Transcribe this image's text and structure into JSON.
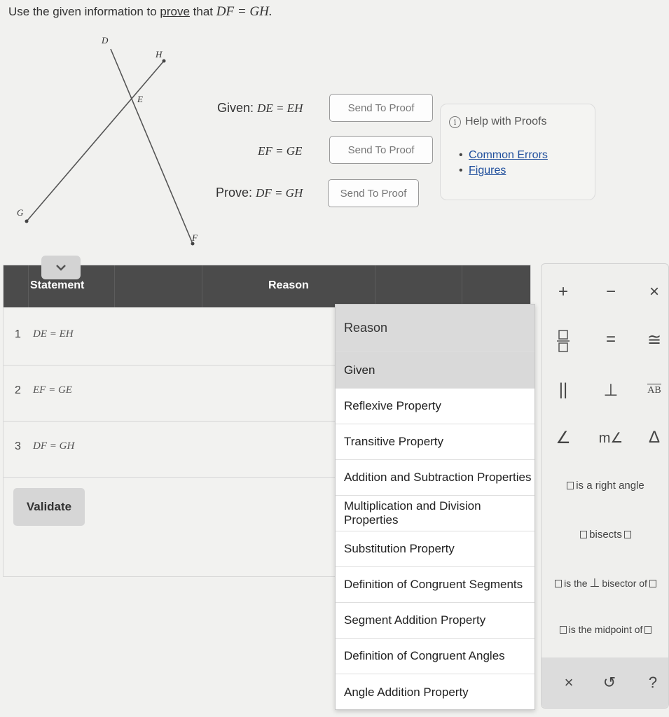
{
  "instruction": {
    "prefix": "Use the given information to",
    "link": "prove",
    "middle": "that",
    "equation": "DF = GH."
  },
  "diagram": {
    "points": [
      "D",
      "H",
      "E",
      "G",
      "F"
    ]
  },
  "givens": [
    {
      "label": "Given:",
      "expression": "DE = EH",
      "button": "Send To Proof"
    },
    {
      "label": "",
      "expression": "EF = GE",
      "button": "Send To Proof"
    }
  ],
  "prove": {
    "label": "Prove:",
    "expression": "DF = GH",
    "button": "Send To Proof"
  },
  "help": {
    "title": "Help with Proofs",
    "links": [
      "Common Errors",
      "Figures"
    ]
  },
  "proof_table": {
    "headers": {
      "statement": "Statement",
      "reason": "Reason"
    },
    "rows": [
      {
        "num": "1",
        "statement": "DE = EH"
      },
      {
        "num": "2",
        "statement": "EF = GE"
      },
      {
        "num": "3",
        "statement": "DF = GH"
      }
    ],
    "validate": "Validate"
  },
  "reason_menu": {
    "header": "Reason",
    "selected": "Given",
    "items": [
      "Given",
      "Reflexive Property",
      "Transitive Property",
      "Addition and Subtraction Properties",
      "Multiplication and Division Properties",
      "Substitution Property",
      "Definition of Congruent Segments",
      "Segment Addition Property",
      "Definition of Congruent Angles",
      "Angle Addition Property"
    ]
  },
  "palette": {
    "row1": [
      "+",
      "−",
      "×"
    ],
    "row2": [
      "fraction",
      "=",
      "≅"
    ],
    "row3": [
      "||",
      "⊥",
      "AB"
    ],
    "row4": [
      "∠",
      "m∠",
      "Δ"
    ],
    "right_angle": "is a right angle",
    "bisects": "bisects",
    "perp_bisector_a": "is the",
    "perp_bisector_b": "bisector of",
    "midpoint": "is the midpoint of",
    "footer": [
      "×",
      "↺",
      "?"
    ]
  }
}
